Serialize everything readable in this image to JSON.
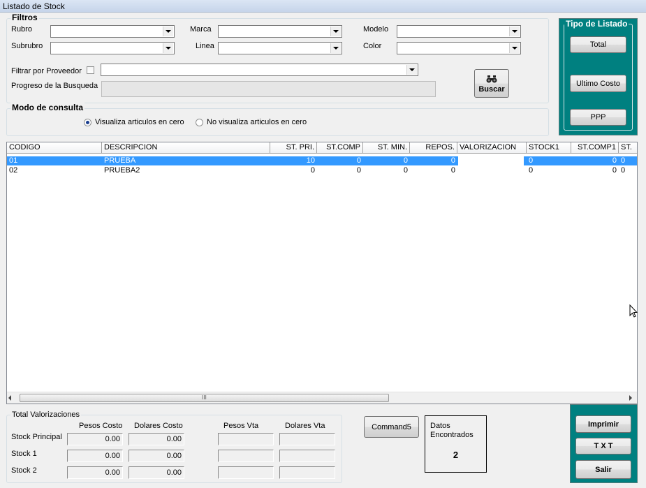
{
  "window": {
    "title": "Listado de Stock"
  },
  "filtros": {
    "title": "Filtros",
    "rubro_label": "Rubro",
    "marca_label": "Marca",
    "modelo_label": "Modelo",
    "subrubro_label": "Subrubro",
    "linea_label": "Linea",
    "color_label": "Color",
    "proveedor_label": "Filtrar por Proveedor",
    "progreso_label": "Progreso de la Busqueda",
    "buscar_label": "Buscar"
  },
  "tipo_listado": {
    "title": "Tipo de Listado",
    "total_label": "Total",
    "ultimo_costo_label": "Ultimo Costo",
    "ppp_label": "PPP"
  },
  "modo_consulta": {
    "title": "Modo de consulta",
    "option1": "Visualiza articulos en cero",
    "option2": "No visualiza articulos en cero",
    "selected": 1
  },
  "grid": {
    "columns": [
      "CODIGO",
      "DESCRIPCION",
      "ST. PRI.",
      "ST.COMP",
      "ST. MIN.",
      "REPOS.",
      "VALORIZACION",
      "STOCK1",
      "ST.COMP1",
      "ST."
    ],
    "rows": [
      [
        "01",
        "PRUEBA",
        "10",
        "0",
        "0",
        "0",
        "",
        "0",
        "0",
        "0"
      ],
      [
        "02",
        "PRUEBA2",
        "0",
        "0",
        "0",
        "0",
        "",
        "0",
        "0",
        "0"
      ]
    ],
    "scroll_grip": "III"
  },
  "totales": {
    "title": "Total Valorizaciones",
    "col_pesos_costo": "Pesos Costo",
    "col_dolares_costo": "Dolares Costo",
    "col_pesos_vta": "Pesos Vta",
    "col_dolares_vta": "Dolares Vta",
    "row_principal": "Stock Principal",
    "row_stock1": "Stock 1",
    "row_stock2": "Stock 2",
    "principal": {
      "pesos_costo": "0.00",
      "dolares_costo": "0.00"
    },
    "stock1": {
      "pesos_costo": "0.00",
      "dolares_costo": "0.00"
    },
    "stock2": {
      "pesos_costo": "0.00",
      "dolares_costo": "0.00"
    }
  },
  "command5_label": "Command5",
  "datos": {
    "label_line1": "Datos",
    "label_line2": "Encontrados",
    "count": "2"
  },
  "actions": {
    "imprimir_label": "Imprimir",
    "txt_label": "T X T",
    "salir_label": "Salir"
  }
}
